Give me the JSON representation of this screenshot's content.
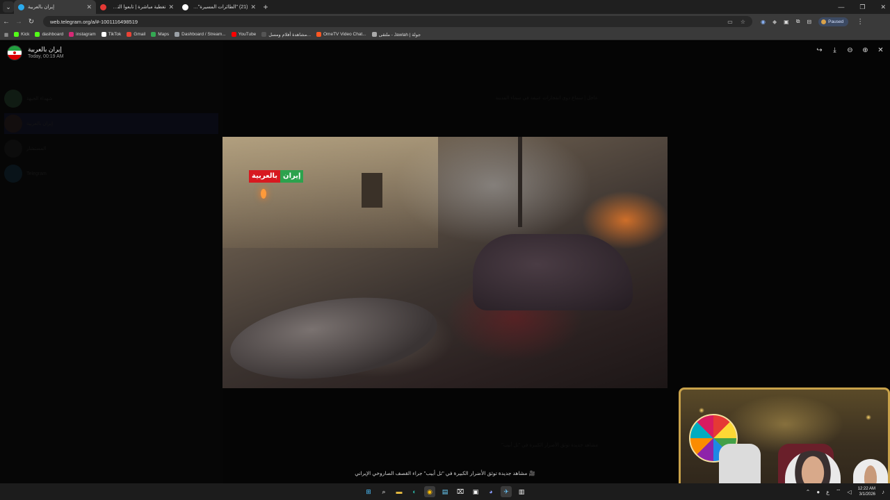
{
  "browser": {
    "tabs": [
      {
        "title": "إيران بالعربية",
        "favicon_color": "#2aabee",
        "active": true
      },
      {
        "title": "تغطية مباشرة | تابعوا التطورات",
        "favicon_color": "#e53935",
        "active": false
      },
      {
        "title": "(21) \"الطائرات المسيرة\" - X / •ch",
        "favicon_color": "#111111",
        "active": false
      }
    ],
    "new_tab": "+",
    "window_controls": [
      "—",
      "❐",
      "✕"
    ],
    "url": "web.telegram.org/a/#-1001116498519",
    "profile_status": "Paused",
    "bookmarks": [
      {
        "label": "Kick",
        "color": "#53fc18"
      },
      {
        "label": "dashboard",
        "color": "#53fc18"
      },
      {
        "label": "instagram",
        "color": "#d62976"
      },
      {
        "label": "TikTok",
        "color": "#ffffff"
      },
      {
        "label": "Gmail",
        "color": "#ea4335"
      },
      {
        "label": "Maps",
        "color": "#34a853"
      },
      {
        "label": "Dashboard / Stream...",
        "color": "#9aa0a6"
      },
      {
        "label": "YouTube",
        "color": "#ff0000"
      },
      {
        "label": "مشاهدة أفلام ومسل...",
        "color": "#555555"
      },
      {
        "label": "OmeTV Video Chat...",
        "color": "#ff5722"
      },
      {
        "label": "ملتقى - Jawlah | جولة",
        "color": "#aaaaaa"
      }
    ]
  },
  "viewer": {
    "channel_name": "إيران بالعربية",
    "timestamp": "Today, 00:19 AM",
    "actions": [
      "share-icon",
      "download-icon",
      "zoom-out-icon",
      "zoom-in-icon",
      "close-icon"
    ],
    "video_logo": {
      "left": "بالعربية",
      "right": "إيران"
    },
    "caption": "🎥 مشاهد جديدة توثق الأضرار الكبيرة في \"تل أبيب\" جراء القصف الصاروخي الإيراني"
  },
  "sidebar": {
    "chats": [
      {
        "name": "شهداء الجبهة",
        "selected": false
      },
      {
        "name": "إيران بالعربية",
        "selected": true
      },
      {
        "name": "المستشار",
        "selected": false
      },
      {
        "name": "Telegram",
        "selected": false
      }
    ]
  },
  "background_post": {
    "line1": "عاجل | سماع دوي انفجارات عنيفة في سماء المدينة",
    "line2": "مشاهد جديدة توثق الأضرار الكبيرة في \"تل أبيب\""
  },
  "taskbar": {
    "time": "12:22 AM",
    "date": "3/1/2026",
    "lang": "ع"
  }
}
